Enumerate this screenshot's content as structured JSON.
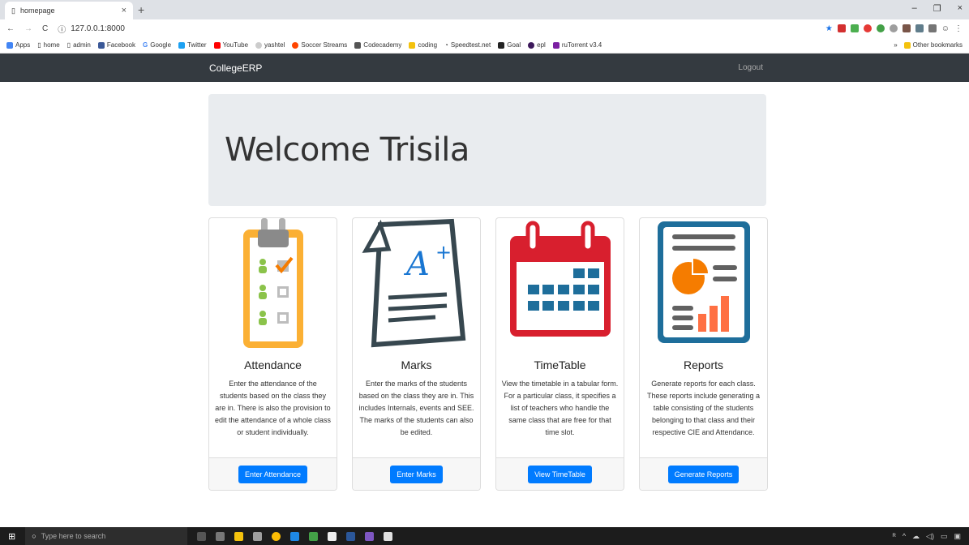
{
  "browser": {
    "tab_title": "homepage",
    "tab_close": "×",
    "new_tab": "+",
    "url": "127.0.0.1:8000",
    "win_min": "–",
    "win_max": "❐",
    "win_close": "×",
    "bookmarks": [
      "Apps",
      "home",
      "admin",
      "Facebook",
      "Google",
      "Twitter",
      "YouTube",
      "yashtel",
      "Soccer Streams",
      "Codecademy",
      "coding",
      "Speedtest.net",
      "Goal",
      "epl",
      "ruTorrent v3.4"
    ],
    "other_bookmarks": "Other bookmarks"
  },
  "navbar": {
    "brand": "CollegeERP",
    "logout": "Logout"
  },
  "jumbotron": {
    "title": "Welcome Trisila"
  },
  "cards": [
    {
      "title": "Attendance",
      "text": "Enter the attendance of the students based on the class they are in. There is also the provision to edit the attendance of a whole class or student individually.",
      "button": "Enter Attendance"
    },
    {
      "title": "Marks",
      "text": "Enter the marks of the students based on the class they are in. This includes Internals, events and SEE. The marks of the students can also be edited.",
      "button": "Enter Marks"
    },
    {
      "title": "TimeTable",
      "text": "View the timetable in a tabular form. For a particular class, it specifies a list of teachers who handle the same class that are free for that time slot.",
      "button": "View TimeTable"
    },
    {
      "title": "Reports",
      "text": "Generate reports for each class. These reports include generating a table consisting of the students belonging to that class and their respective CIE and Attendance.",
      "button": "Generate Reports"
    }
  ],
  "taskbar": {
    "search_placeholder": "Type here to search"
  },
  "colors": {
    "navbar": "#343a40",
    "primary": "#007bff",
    "jumbotron": "#e9ecef"
  }
}
